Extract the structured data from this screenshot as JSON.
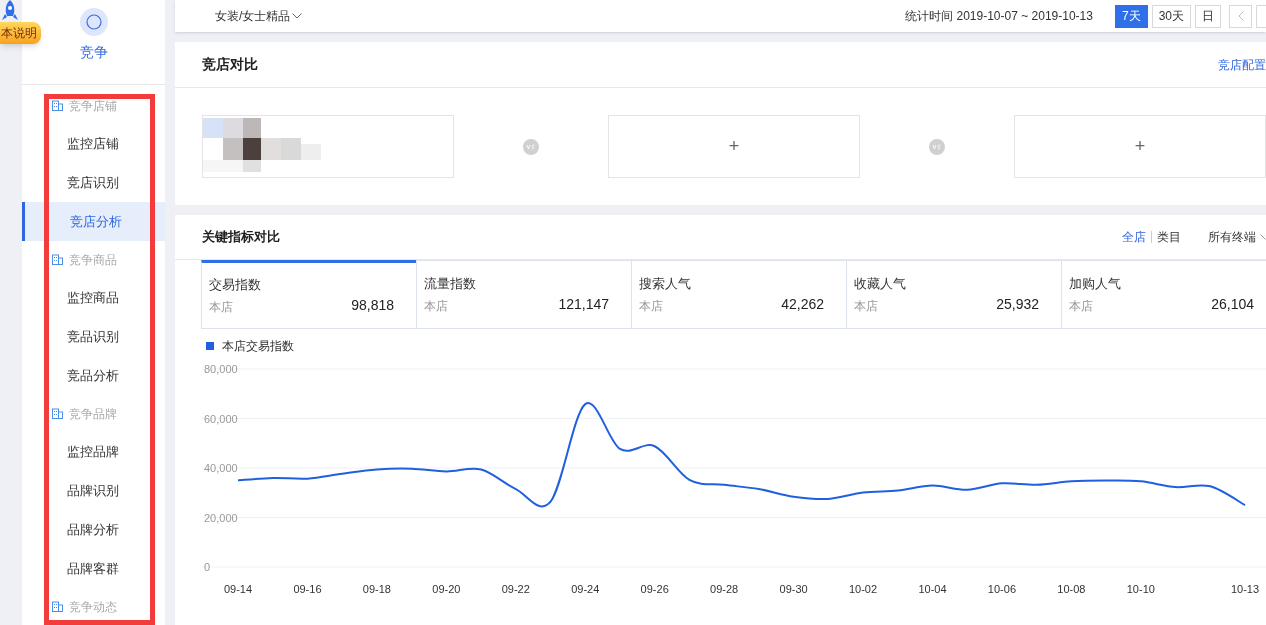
{
  "help_badge": {
    "label": "本说明"
  },
  "sidebar": {
    "title": "竞争",
    "groups": [
      {
        "label": "竞争店铺",
        "items": [
          {
            "label": "监控店铺",
            "selected": false
          },
          {
            "label": "竞店识别",
            "selected": false
          },
          {
            "label": "竞店分析",
            "selected": true
          }
        ]
      },
      {
        "label": "竞争商品",
        "items": [
          {
            "label": "监控商品",
            "selected": false
          },
          {
            "label": "竞品识别",
            "selected": false
          },
          {
            "label": "竞品分析",
            "selected": false
          }
        ]
      },
      {
        "label": "竞争品牌",
        "items": [
          {
            "label": "监控品牌",
            "selected": false
          },
          {
            "label": "品牌识别",
            "selected": false
          },
          {
            "label": "品牌分析",
            "selected": false
          },
          {
            "label": "品牌客群",
            "selected": false
          }
        ]
      },
      {
        "label": "竞争动态"
      }
    ]
  },
  "top_bar": {
    "category": "女装/女士精品",
    "period_label": "统计时间 2019-10-07 ~ 2019-10-13",
    "ranges": [
      {
        "label": "7天",
        "selected": true
      },
      {
        "label": "30天",
        "selected": false
      },
      {
        "label": "日",
        "selected": false
      }
    ]
  },
  "compare": {
    "title": "竞店对比",
    "config_link": "竞店配置",
    "slots": [
      {
        "kind": "store"
      },
      {
        "kind": "add",
        "symbol": "+"
      },
      {
        "kind": "add",
        "symbol": "+"
      }
    ]
  },
  "metrics": {
    "title": "关键指标对比",
    "scopes": [
      {
        "label": "全店",
        "selected": true
      },
      {
        "label": "类目",
        "selected": false
      }
    ],
    "terminal": "所有终端",
    "tabs": [
      {
        "label": "交易指数",
        "sub": "本店",
        "value": "98,818",
        "selected": true
      },
      {
        "label": "流量指数",
        "sub": "本店",
        "value": "121,147",
        "selected": false
      },
      {
        "label": "搜索人气",
        "sub": "本店",
        "value": "42,262",
        "selected": false
      },
      {
        "label": "收藏人气",
        "sub": "本店",
        "value": "25,932",
        "selected": false
      },
      {
        "label": "加购人气",
        "sub": "本店",
        "value": "26,104",
        "selected": false
      }
    ],
    "chart_data": {
      "type": "line",
      "categories": [
        "09-14",
        null,
        "09-16",
        null,
        "09-18",
        null,
        "09-20",
        null,
        "09-22",
        null,
        "09-24",
        null,
        "09-26",
        null,
        "09-28",
        null,
        "09-30",
        null,
        "10-02",
        null,
        "10-04",
        null,
        "10-06",
        null,
        "10-08",
        null,
        "10-10",
        null,
        null,
        "10-13"
      ],
      "series": [
        {
          "name": "本店交易指数",
          "color": "#1f5fe0",
          "values": [
            35000,
            36000,
            35700,
            37700,
            39400,
            39700,
            38600,
            39400,
            31500,
            26400,
            65800,
            47700,
            48800,
            35200,
            33200,
            31500,
            28400,
            27500,
            30100,
            30900,
            32900,
            31200,
            33800,
            33200,
            34600,
            34900,
            34600,
            32300,
            32600,
            25000
          ]
        }
      ],
      "ylim": [
        0,
        80000
      ],
      "yticks": [
        {
          "value": 0,
          "label": "0"
        },
        {
          "value": 20000,
          "label": "20,000"
        },
        {
          "value": 40000,
          "label": "40,000"
        },
        {
          "value": 60000,
          "label": "60,000"
        },
        {
          "value": 80000,
          "label": "80,000"
        }
      ],
      "grid": true
    }
  }
}
